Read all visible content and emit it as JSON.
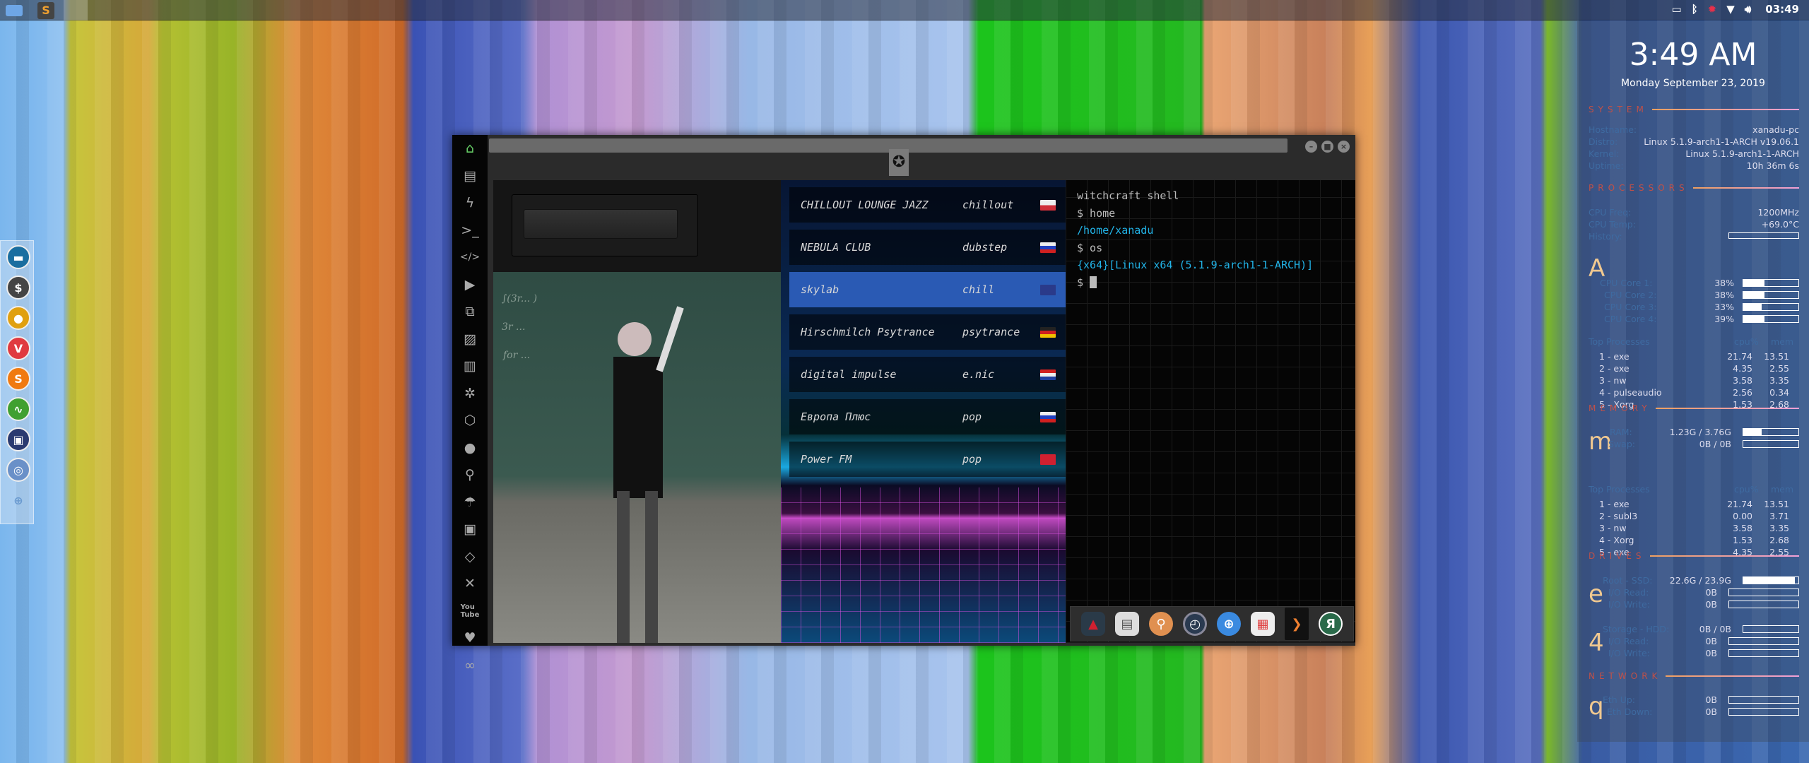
{
  "topbar": {
    "apps": [
      "file-manager",
      "sublime-text",
      "browser"
    ],
    "tray": [
      "screenshot-icon",
      "bluetooth-icon",
      "alert-icon",
      "wifi-icon",
      "volume-icon"
    ],
    "time": "03:49"
  },
  "dock": {
    "apps": [
      "archive-manager",
      "terminal",
      "screenshot",
      "vivaldi",
      "sublime",
      "system-monitor",
      "image-viewer",
      "chromium",
      "web-browser"
    ]
  },
  "window": {
    "sidebar": [
      "home",
      "document",
      "flash",
      "terminal",
      "code",
      "play",
      "translate",
      "image",
      "news",
      "galactic-empire",
      "hexagon",
      "globe",
      "search",
      "umbrella",
      "contacts",
      "link",
      "expand",
      "youtube",
      "heart",
      "infinity"
    ],
    "stations": [
      {
        "name": "CHILLOUT LOUNGE JAZZ",
        "genre": "chillout",
        "flag": "pl",
        "selected": false
      },
      {
        "name": "NEBULA CLUB",
        "genre": "dubstep",
        "flag": "ru",
        "selected": false
      },
      {
        "name": "skylab",
        "genre": "chill",
        "flag": "gb",
        "selected": true
      },
      {
        "name": "Hirschmilch Psytrance",
        "genre": "psytrance",
        "flag": "de",
        "selected": false
      },
      {
        "name": "digital impulse",
        "genre": "e.nic",
        "flag": "hr",
        "selected": false
      },
      {
        "name": "Европа Плюс",
        "genre": "pop",
        "flag": "ru",
        "selected": false
      },
      {
        "name": "Power FM",
        "genre": "pop",
        "flag": "tr",
        "selected": false
      }
    ],
    "terminal": {
      "title": "witchcraft shell",
      "l1": "$ home",
      "l2": "/home/xanadu",
      "l3": "$ os",
      "l4": "{x64}[Linux x64 (5.1.9-arch1-1-ARCH)]",
      "prompt": "$"
    },
    "dock": [
      "app-launcher",
      "news",
      "search",
      "clock",
      "globe",
      "calendar",
      "sublime",
      "yandex"
    ],
    "yandex_glyph": "Я"
  },
  "conky": {
    "time": "3:49 AM",
    "date": "Monday September 23, 2019",
    "system": {
      "title": "SYSTEM",
      "rows": [
        [
          "Hostname:",
          "xanadu-pc"
        ],
        [
          "Distro:",
          "Linux 5.1.9-arch1-1-ARCH v19.06.1"
        ],
        [
          "Kernel:",
          "Linux 5.1.9-arch1-1-ARCH"
        ],
        [
          "Uptime:",
          "10h 36m 6s"
        ]
      ]
    },
    "processors": {
      "title": "PROCESSORS",
      "freq_label": "CPU Freq:",
      "freq": "1200MHz",
      "temp_label": "CPU Temp:",
      "temp": "+69.0°C",
      "history_label": "History:",
      "glyph": "A",
      "cores": [
        {
          "label": "CPU Core 1:",
          "value": "38%",
          "pct": 38
        },
        {
          "label": "CPU Core 2:",
          "value": "38%",
          "pct": 38
        },
        {
          "label": "CPU Core 3:",
          "value": "33%",
          "pct": 33
        },
        {
          "label": "CPU Core 4:",
          "value": "39%",
          "pct": 39
        }
      ],
      "top_label": "Top Processes",
      "cpu_col": "cpu%",
      "mem_col": "mem",
      "procs": [
        [
          "1 - exe",
          "21.74",
          "13.51"
        ],
        [
          "2 - exe",
          "4.35",
          "2.55"
        ],
        [
          "3 - nw",
          "3.58",
          "3.35"
        ],
        [
          "4 - pulseaudio",
          "2.56",
          "0.34"
        ],
        [
          "5 - Xorg",
          "1.53",
          "2.68"
        ]
      ]
    },
    "memory": {
      "title": "MEMORY",
      "glyph": "m",
      "ram_label": "RAM:",
      "ram": "1.23G / 3.76G",
      "ram_pct": 33,
      "swap_label": "Swap:",
      "swap": "0B / 0B",
      "swap_pct": 0,
      "top_label": "Top Processes",
      "cpu_col": "cpu%",
      "mem_col": "mem",
      "procs": [
        [
          "1 - exe",
          "21.74",
          "13.51"
        ],
        [
          "2 - subl3",
          "0.00",
          "3.71"
        ],
        [
          "3 - nw",
          "3.58",
          "3.35"
        ],
        [
          "4 - Xorg",
          "1.53",
          "2.68"
        ],
        [
          "5 - exe",
          "4.35",
          "2.55"
        ]
      ]
    },
    "drives": {
      "title": "DRIVES",
      "root": {
        "glyph": "e",
        "label": "Root - SSD:",
        "value": "22.6G / 23.9G",
        "pct": 94,
        "read_label": "I/O Read:",
        "read": "0B",
        "write_label": "I/O Write:",
        "write": "0B"
      },
      "storage": {
        "glyph": "4",
        "label": "Storage - HDD:",
        "value": "0B / 0B",
        "pct": 0,
        "read_label": "I/O Read:",
        "read": "0B",
        "write_label": "I/O Write:",
        "write": "0B"
      }
    },
    "network": {
      "title": "NETWORK",
      "glyph": "q",
      "up_label": "Eth Up:",
      "up": "0B",
      "down_label": "Eth Down:",
      "down": "0B"
    }
  },
  "colors": {
    "accent_blue": "#22b4e8",
    "selected_row": "#2a5ab4",
    "conky_header": "#c05048",
    "conky_label": "#3e6aa0"
  }
}
